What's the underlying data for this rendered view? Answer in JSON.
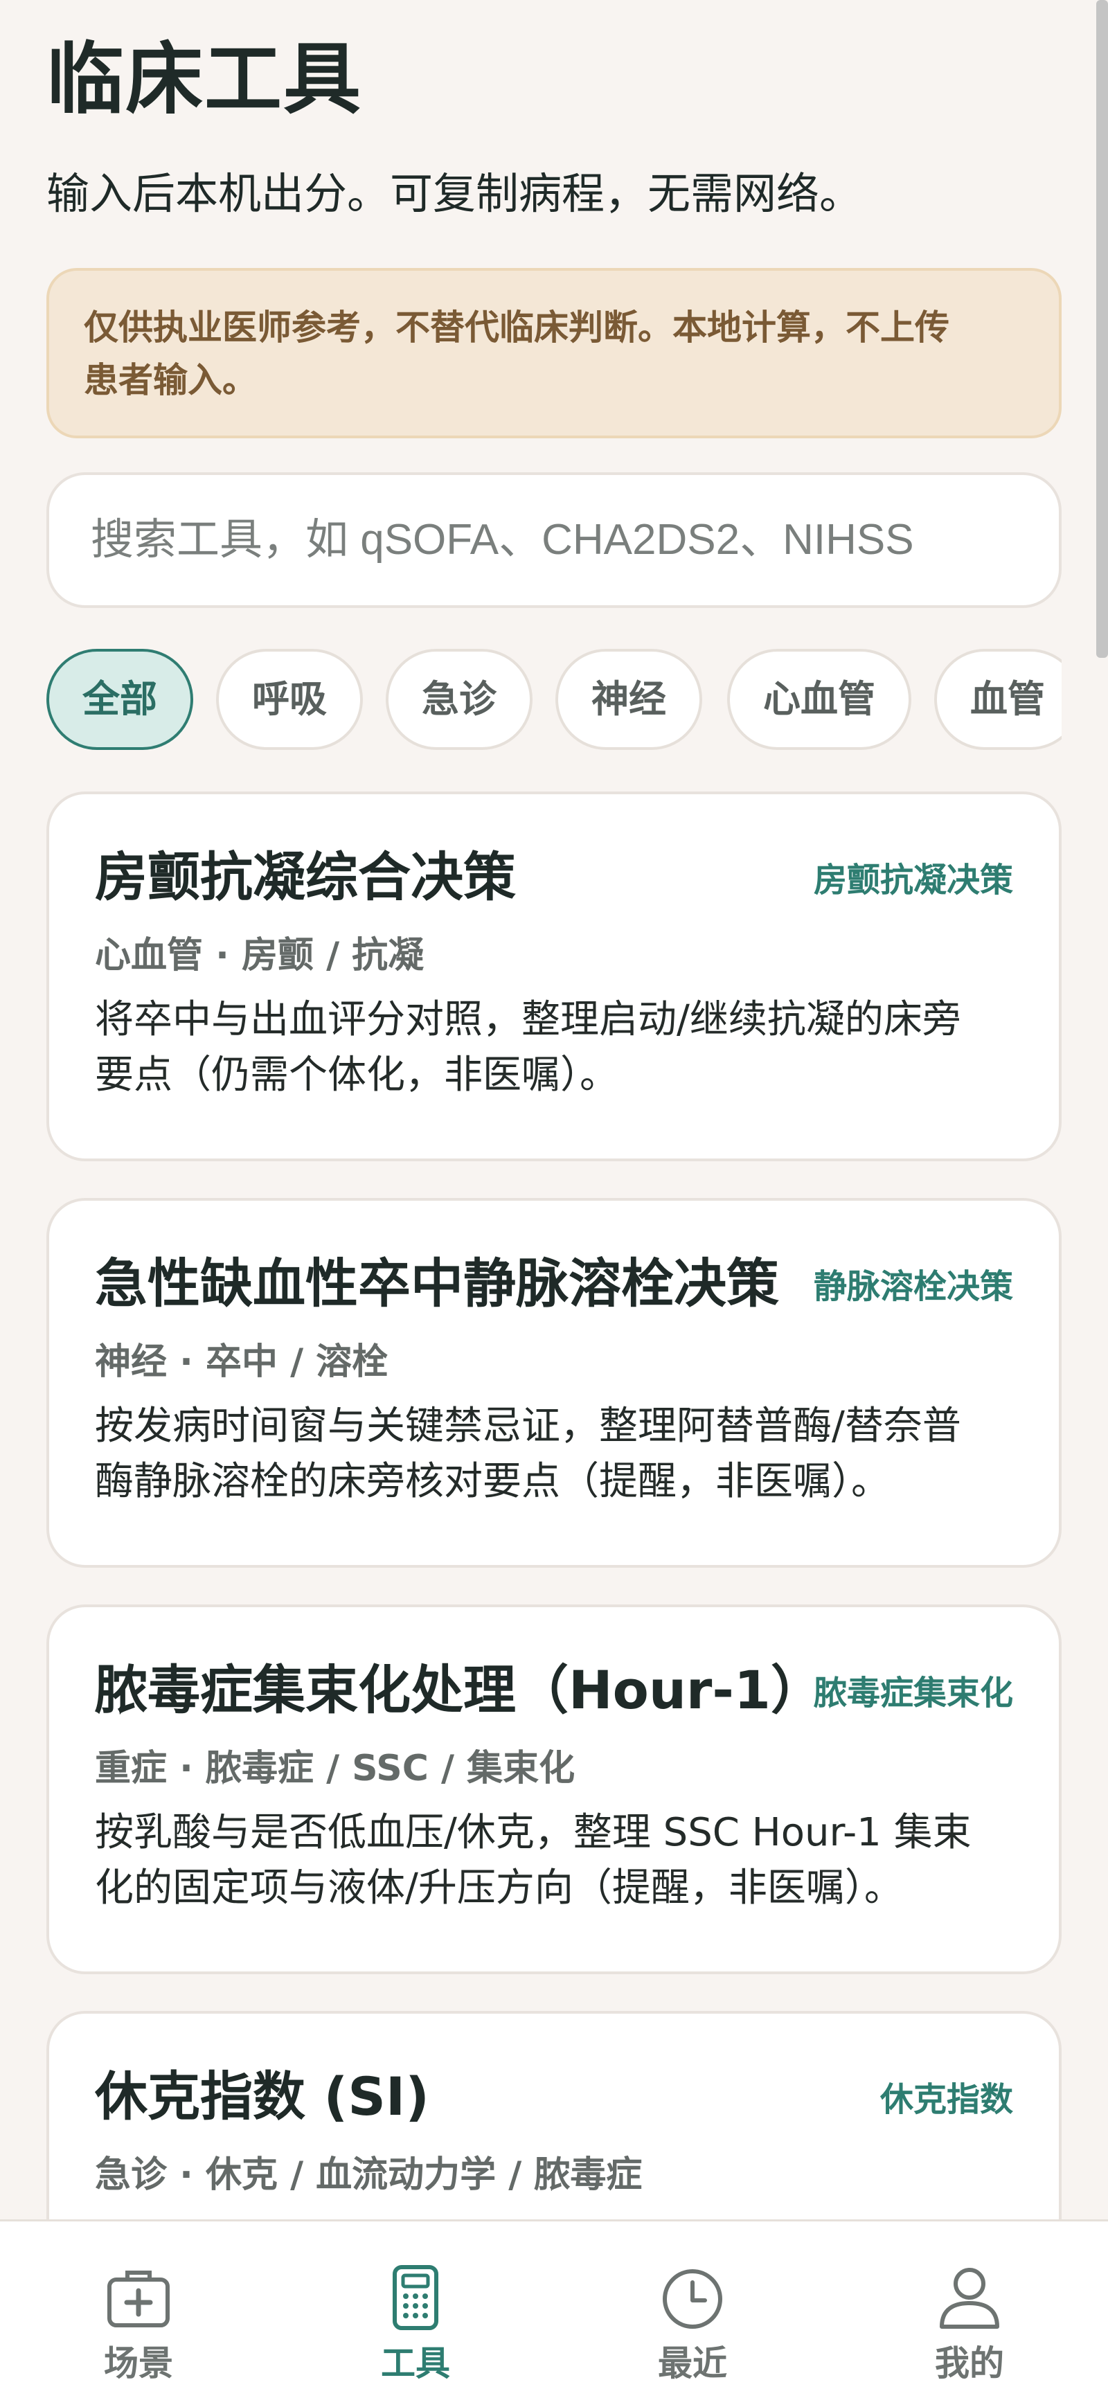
{
  "header": {
    "title": "临床工具",
    "subtitle": "输入后本机出分。可复制病程，无需网络。"
  },
  "warning": {
    "line1": "仅供执业医师参考，不替代临床判断。本地计算，不上传",
    "line2": "患者输入。"
  },
  "search": {
    "placeholder": "搜索工具，如 qSOFA、CHA2DS2、NIHSS"
  },
  "chips": [
    {
      "label": "全部",
      "active": true
    },
    {
      "label": "呼吸",
      "active": false
    },
    {
      "label": "急诊",
      "active": false
    },
    {
      "label": "神经",
      "active": false
    },
    {
      "label": "心血管",
      "active": false
    },
    {
      "label": "血管",
      "active": false
    }
  ],
  "cards": [
    {
      "title": "房颤抗凝综合决策",
      "tag": "房颤抗凝决策",
      "meta": "心血管 · 房颤 / 抗凝",
      "desc1": "将卒中与出血评分对照，整理启动/继续抗凝的床旁",
      "desc2": "要点（仍需个体化，非医嘱）。"
    },
    {
      "title": "急性缺血性卒中静脉溶栓决策",
      "tag": "静脉溶栓决策",
      "meta": "神经 · 卒中 / 溶栓",
      "desc1": "按发病时间窗与关键禁忌证，整理阿替普酶/替奈普",
      "desc2": "酶静脉溶栓的床旁核对要点（提醒，非医嘱）。"
    },
    {
      "title": "脓毒症集束化处理（Hour-1）",
      "tag": "脓毒症集束化",
      "meta": "重症 · 脓毒症 / SSC / 集束化",
      "desc1": "按乳酸与是否低血压/休克，整理 SSC Hour-1 集束",
      "desc2": "化的固定项与液体/升压方向（提醒，非医嘱）。"
    },
    {
      "title": "休克指数 (SI)",
      "tag": "休克指数",
      "meta": "急诊 · 休克 / 血流动力学 / 脓毒症",
      "desc1": "",
      "desc2": ""
    }
  ],
  "tabbar": {
    "tabs": [
      {
        "label": "场景",
        "icon": "medical-kit-icon",
        "active": false
      },
      {
        "label": "工具",
        "icon": "calculator-icon",
        "active": true
      },
      {
        "label": "最近",
        "icon": "clock-icon",
        "active": false
      },
      {
        "label": "我的",
        "icon": "user-icon",
        "active": false
      }
    ]
  },
  "colors": {
    "accent": "#2e7d71",
    "background": "#f8f4f1",
    "warning_bg": "#f4e7d6",
    "warning_text": "#7a5a35"
  }
}
